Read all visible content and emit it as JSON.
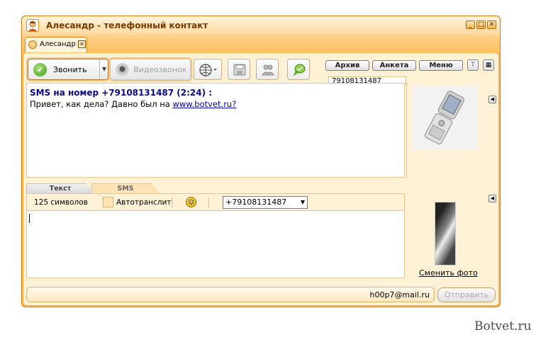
{
  "window": {
    "title": "Алесандр - телефонный контакт",
    "controls": {
      "minimize": "_",
      "maximize": "□",
      "close": "✕"
    }
  },
  "tab": {
    "label": "Алесандр",
    "close": "✕"
  },
  "toolbar": {
    "call_label": "Звонить",
    "video_label": "Видеозвонок",
    "archive_label": "Архив",
    "profile_label": "Анкета",
    "menu_label": "Меню"
  },
  "chat": {
    "phone_tab": "79108131487",
    "header": "SMS на номер +79108131487 (2:24) :",
    "body_prefix": "Привет, как дела? Давно был на ",
    "link": "www.botvet.ru?"
  },
  "input_tabs": {
    "text": "Текст",
    "sms": "SMS"
  },
  "sms": {
    "char_count": "125 символов",
    "translit_label": "Автотранслит",
    "phone_value": "+79108131487"
  },
  "side": {
    "change_photo": "Сменить фото"
  },
  "status": {
    "email": "h00p7@mail.ru"
  },
  "send_label": "Отправить",
  "watermark": "Botvet.ru",
  "colors": {
    "frame": "#fbb24a",
    "panel": "#fff1d6",
    "header_text": "#0a0a8c",
    "title_text": "#7a3a00"
  }
}
